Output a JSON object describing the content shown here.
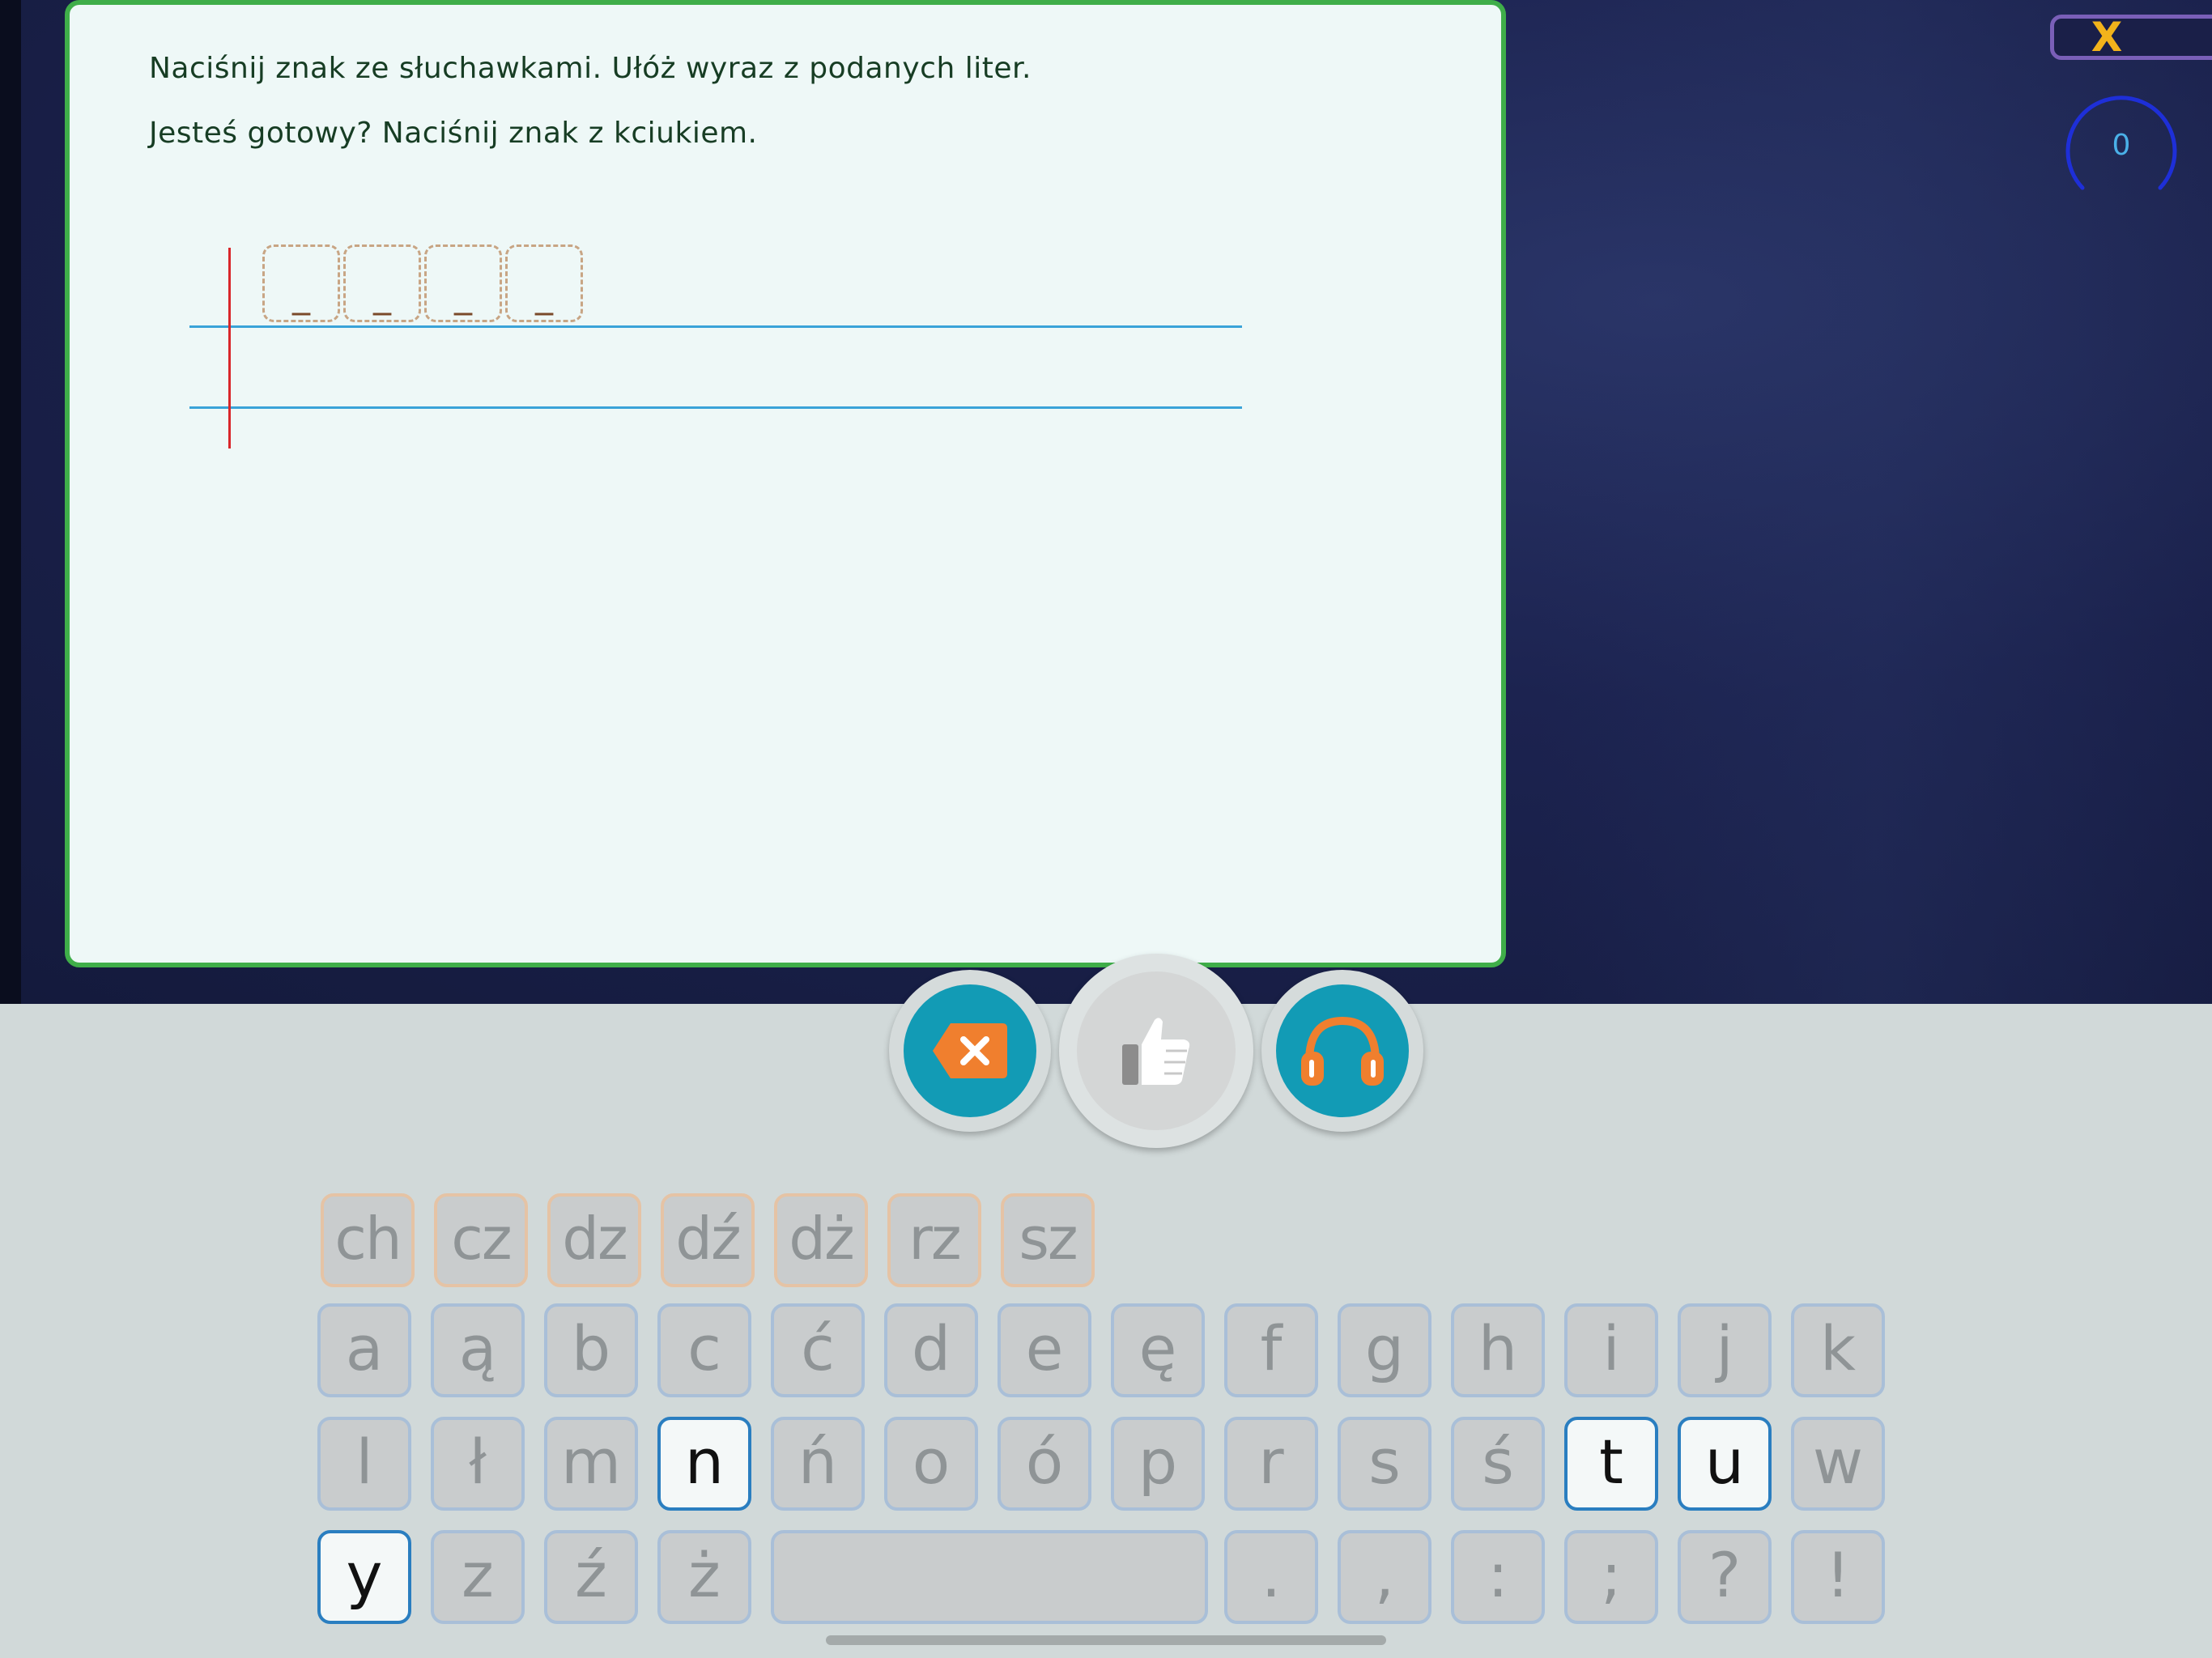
{
  "app": {
    "instructions": [
      "Naciśnij znak ze słuchawkami. Ułóż wyraz z podanych liter.",
      "Jesteś gotowy? Naciśnij znak z kciukiem."
    ],
    "close_label": "X",
    "score": "0"
  },
  "answer_slots": [
    "_",
    "_",
    "_",
    "_"
  ],
  "actions": {
    "erase_icon": "backspace-icon",
    "confirm_icon": "thumbs-up-icon",
    "listen_icon": "headphones-icon"
  },
  "keyboard": {
    "row0": [
      "ch",
      "cz",
      "dz",
      "dź",
      "dż",
      "rz",
      "sz"
    ],
    "row1": [
      "a",
      "ą",
      "b",
      "c",
      "ć",
      "d",
      "e",
      "ę",
      "f",
      "g",
      "h",
      "i",
      "j",
      "k"
    ],
    "row2": [
      "l",
      "ł",
      "m",
      "n",
      "ń",
      "o",
      "ó",
      "p",
      "r",
      "s",
      "ś",
      "t",
      "u",
      "w"
    ],
    "row3": [
      "y",
      "z",
      "ź",
      "ż",
      "",
      ".",
      ",",
      ":",
      ";",
      "?",
      "!"
    ],
    "active_keys": [
      "n",
      "t",
      "u",
      "y"
    ]
  },
  "colors": {
    "card_border": "#3fae49",
    "accent_teal": "#129bb5",
    "accent_orange": "#f07f2e",
    "close_x": "#f2b31b",
    "score_ring": "#1e2fd8"
  }
}
